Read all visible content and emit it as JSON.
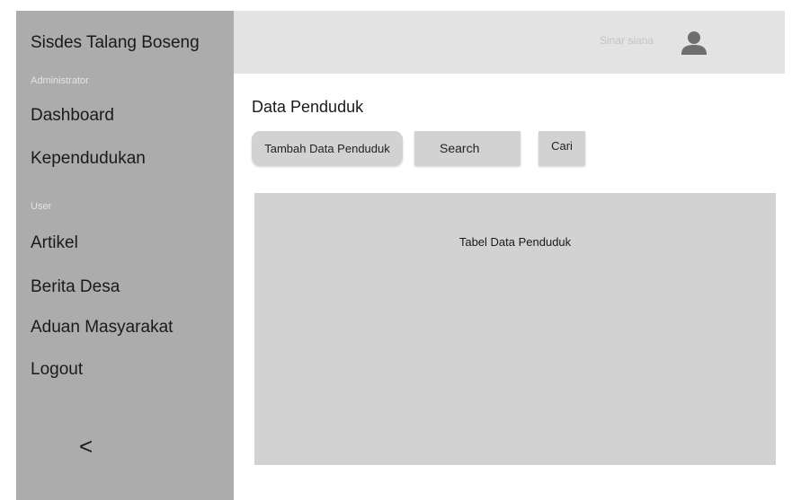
{
  "sidebar": {
    "app_title": "Sisdes Talang Boseng",
    "section_admin": "Administrator",
    "admin_items": [
      "Dashboard",
      "Kependudukan"
    ],
    "section_user": "User",
    "user_items": [
      "Artikel",
      "Berita Desa",
      "Aduan Masyarakat",
      "Logout"
    ],
    "collapse_symbol": "<"
  },
  "header": {
    "user_name": "Sinar siana",
    "avatar_icon": "user-icon"
  },
  "main": {
    "page_title": "Data Penduduk",
    "add_button_label": "Tambah Data Penduduk",
    "search_placeholder": "Search",
    "search_button_label": "Cari",
    "table_label": "Tabel Data Penduduk"
  },
  "colors": {
    "sidebar_bg": "#acacac",
    "topbar_bg": "#e3e3e3",
    "control_bg": "#d2d2d2"
  }
}
